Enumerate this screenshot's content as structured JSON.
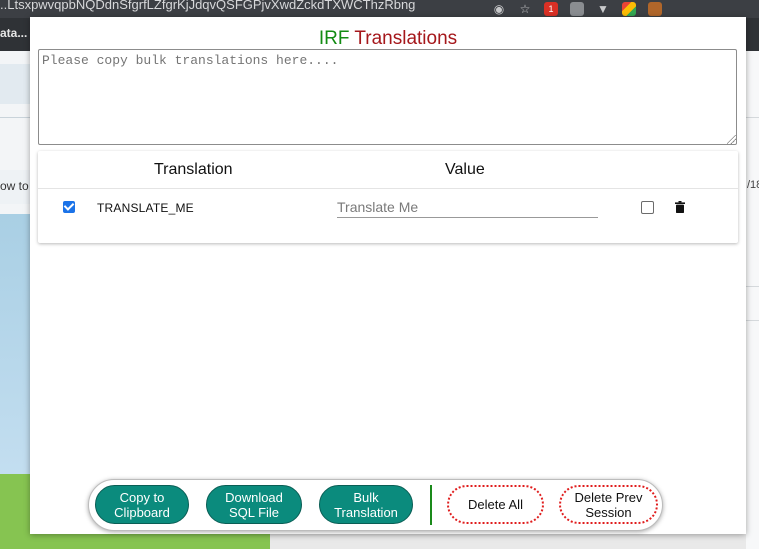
{
  "browser": {
    "url_fragment": "..Ltsxpwvqpb​NQDdnSfgrfLZfgrKjJdqvQSFGPjvXwdZckdTXWCThzRbng",
    "bookmark_label": "ata...",
    "page_text_left": "ow to",
    "page_text_right": "/18"
  },
  "popup": {
    "title_irf": "IRF",
    "title_rest": "Translations",
    "colors": {
      "irf": "#128b12",
      "translations": "#a5171b",
      "accent": "#0b8b7d",
      "danger": "#e01d1d"
    }
  },
  "bulk": {
    "placeholder": "Please copy bulk translations here....",
    "value": ""
  },
  "table": {
    "headers": {
      "translation": "Translation",
      "value": "Value"
    },
    "rows": [
      {
        "selected": true,
        "key": "TRANSLATE_ME",
        "value": "",
        "placeholder": "Translate Me",
        "flag": false
      }
    ]
  },
  "actions": {
    "copy_line1": "Copy to",
    "copy_line2": "Clipboard",
    "sql_line1": "Download",
    "sql_line2": "SQL File",
    "bulk_line1": "Bulk",
    "bulk_line2": "Translation",
    "delete_all": "Delete All",
    "delprev_line1": "Delete Prev",
    "delprev_line2": "Session"
  },
  "icons": {
    "row_delete": "trash-icon",
    "toolbar": [
      "eye-icon",
      "star-icon",
      "extension-icon",
      "camera-icon",
      "vpn-icon",
      "extension-icon",
      "extension-icon"
    ]
  }
}
